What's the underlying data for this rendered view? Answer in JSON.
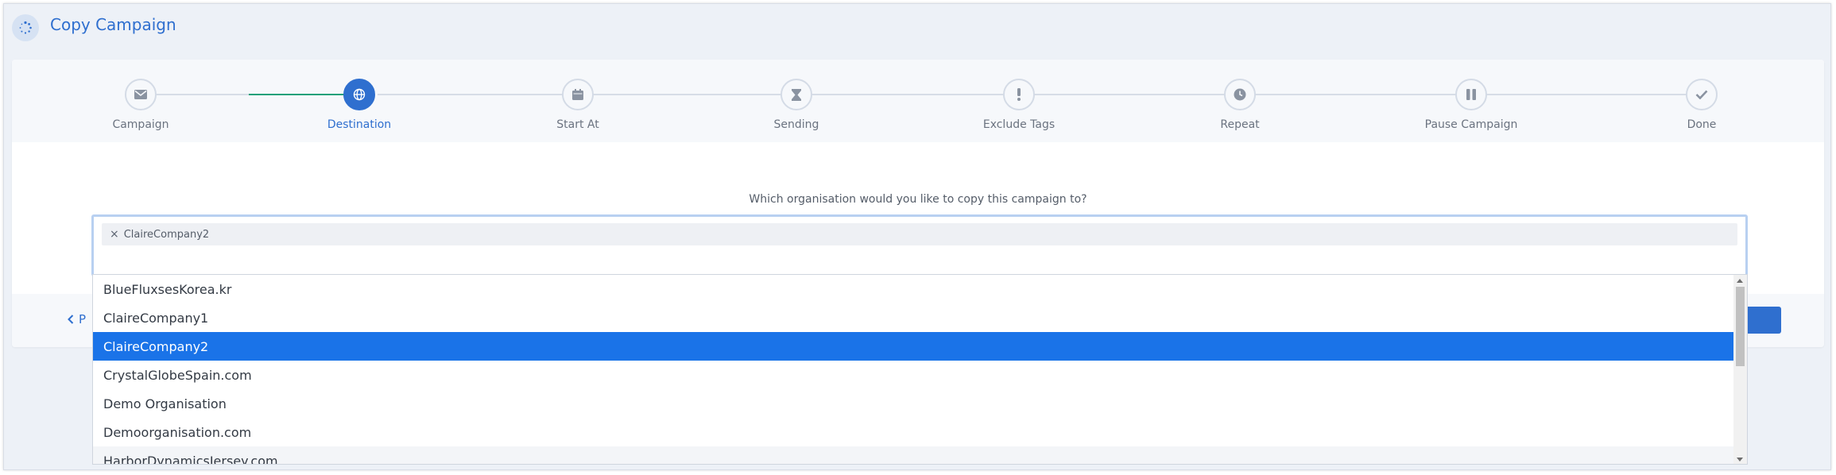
{
  "page": {
    "title": "Copy Campaign"
  },
  "steps": [
    {
      "label": "Campaign",
      "icon": "envelope-icon"
    },
    {
      "label": "Destination",
      "icon": "globe-icon"
    },
    {
      "label": "Start At",
      "icon": "calendar-icon"
    },
    {
      "label": "Sending",
      "icon": "hourglass-icon"
    },
    {
      "label": "Exclude Tags",
      "icon": "exclamation-icon"
    },
    {
      "label": "Repeat",
      "icon": "clock-icon"
    },
    {
      "label": "Pause Campaign",
      "icon": "pause-icon"
    },
    {
      "label": "Done",
      "icon": "check-icon"
    }
  ],
  "active_step": "Destination",
  "question": "Which organisation would you like to copy this campaign to?",
  "selected_tag": {
    "remove": "×",
    "label": "ClaireCompany2"
  },
  "options": [
    "BlueFluxsesKorea.kr",
    "ClaireCompany1",
    "ClaireCompany2",
    "CrystalGlobeSpain.com",
    "Demo Organisation",
    "Demoorganisation.com",
    "HarborDynamicsJersey.com"
  ],
  "selected_option": "ClaireCompany2",
  "footer": {
    "prev_label": "P"
  },
  "colors": {
    "accent": "#2f6fcf",
    "selected_option": "#1a73e8",
    "progress_done": "#1aa179"
  }
}
